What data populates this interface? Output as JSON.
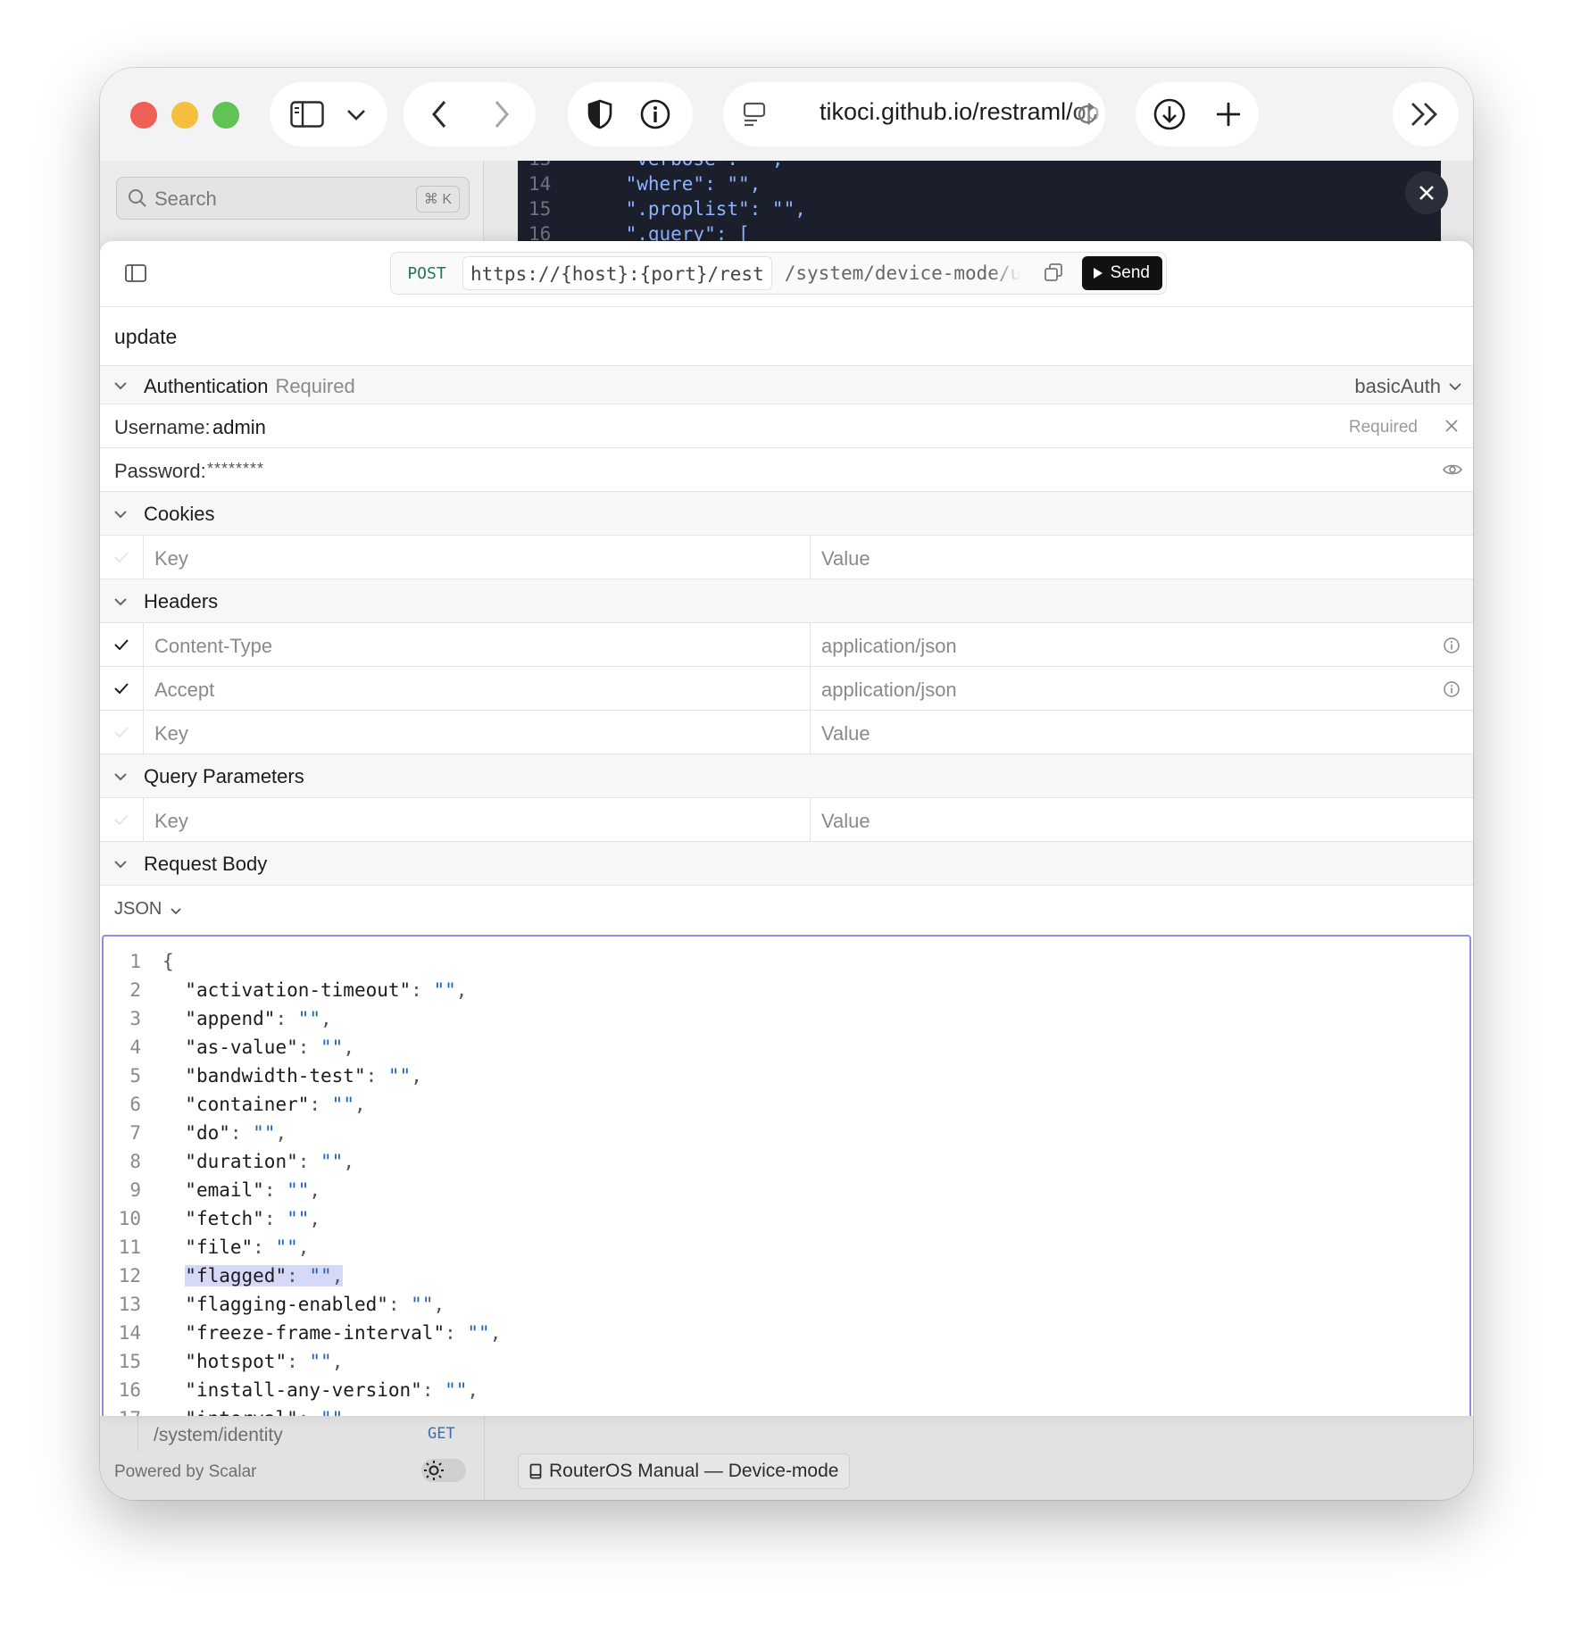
{
  "browser": {
    "url_display": "tikoci.github.io/restraml/op",
    "traffic_lights": {
      "close": "#ed5f57",
      "minimize": "#f5be3f",
      "zoom": "#5fc454"
    }
  },
  "background_page": {
    "search": {
      "placeholder": "Search",
      "shortcut": "⌘ K"
    },
    "code_lines": [
      {
        "n": "13",
        "text": "    \"verbose\": \"\","
      },
      {
        "n": "14",
        "text": "    \"where\": \"\","
      },
      {
        "n": "15",
        "text": "    \".proplist\": \"\","
      },
      {
        "n": "16",
        "text": "    \".query\": ["
      }
    ],
    "sidebar_item": {
      "path": "/system/identity",
      "method": "GET"
    },
    "powered_by": "Powered by Scalar",
    "doc_link": "RouterOS Manual — Device-mode"
  },
  "request": {
    "method": "POST",
    "server": "https://{host}:{port}/rest",
    "path": "/system/device-mode/update",
    "send_label": "Send",
    "name": "update"
  },
  "auth": {
    "title": "Authentication",
    "badge": "Required",
    "scheme": "basicAuth",
    "username_label": "Username:",
    "username_value": "admin",
    "username_required": "Required",
    "password_label": "Password:",
    "password_value": "********"
  },
  "cookies": {
    "title": "Cookies",
    "key_placeholder": "Key",
    "value_placeholder": "Value"
  },
  "headers": {
    "title": "Headers",
    "rows": [
      {
        "key": "Content-Type",
        "value": "application/json"
      },
      {
        "key": "Accept",
        "value": "application/json"
      }
    ],
    "key_placeholder": "Key",
    "value_placeholder": "Value"
  },
  "query": {
    "title": "Query Parameters",
    "key_placeholder": "Key",
    "value_placeholder": "Value"
  },
  "body": {
    "title": "Request Body",
    "format": "JSON",
    "lines": [
      {
        "n": "1",
        "key": "",
        "raw": "{"
      },
      {
        "n": "2",
        "key": "\"activation-timeout\""
      },
      {
        "n": "3",
        "key": "\"append\""
      },
      {
        "n": "4",
        "key": "\"as-value\""
      },
      {
        "n": "5",
        "key": "\"bandwidth-test\""
      },
      {
        "n": "6",
        "key": "\"container\""
      },
      {
        "n": "7",
        "key": "\"do\""
      },
      {
        "n": "8",
        "key": "\"duration\""
      },
      {
        "n": "9",
        "key": "\"email\""
      },
      {
        "n": "10",
        "key": "\"fetch\""
      },
      {
        "n": "11",
        "key": "\"file\""
      },
      {
        "n": "12",
        "key": "\"flagged\"",
        "highlight": true
      },
      {
        "n": "13",
        "key": "\"flagging-enabled\""
      },
      {
        "n": "14",
        "key": "\"freeze-frame-interval\""
      },
      {
        "n": "15",
        "key": "\"hotspot\""
      },
      {
        "n": "16",
        "key": "\"install-any-version\""
      },
      {
        "n": "17",
        "key": "\"interval\""
      }
    ]
  }
}
